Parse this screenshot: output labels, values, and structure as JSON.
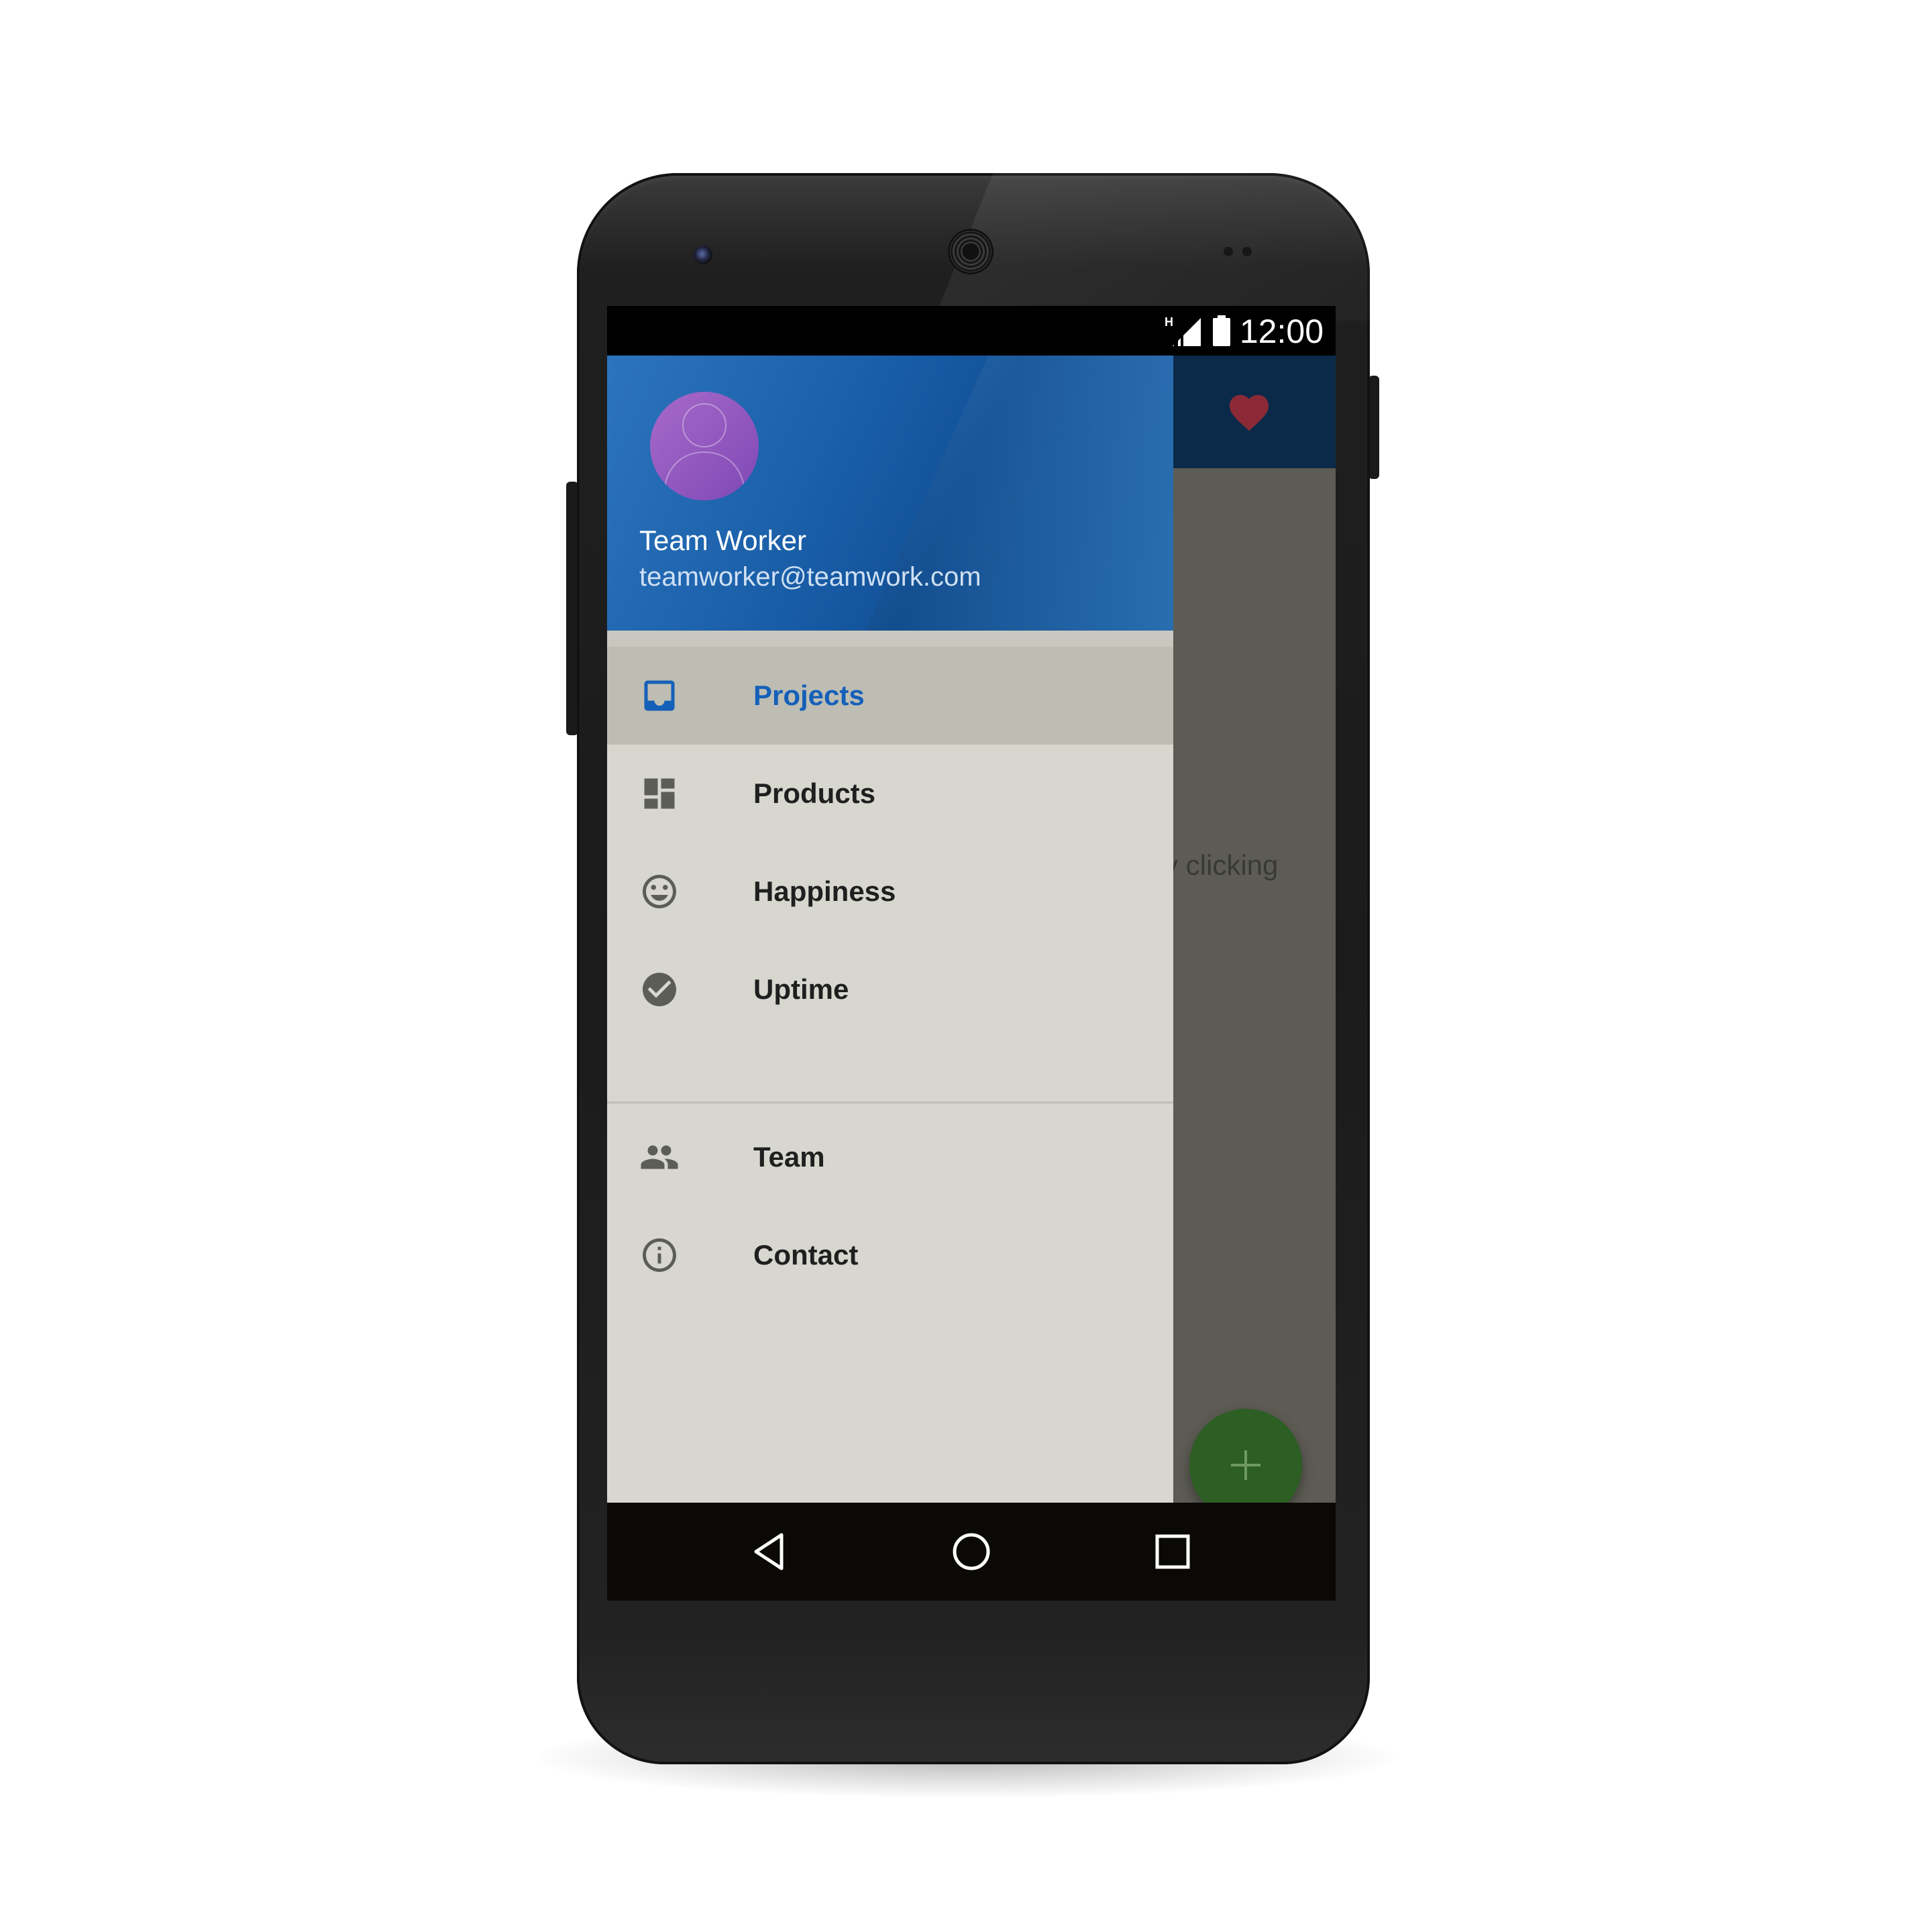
{
  "status_bar": {
    "network_type": "H",
    "icons": [
      "network-type-icon",
      "signal-icon",
      "battery-icon"
    ],
    "time": "12:00"
  },
  "app_behind": {
    "toolbar_icon": "heart-icon",
    "partial_text": "y clicking",
    "fab_icon": "plus-icon"
  },
  "drawer": {
    "header": {
      "avatar_icon": "person-icon",
      "name": "Team Worker",
      "email": "teamworker@teamwork.com"
    },
    "items": [
      {
        "label": "Projects",
        "icon": "inbox-icon",
        "active": true
      },
      {
        "label": "Products",
        "icon": "dashboard-icon",
        "active": false
      },
      {
        "label": "Happiness",
        "icon": "smiley-icon",
        "active": false
      },
      {
        "label": "Uptime",
        "icon": "check-circle-icon",
        "active": false
      }
    ],
    "secondary_items": [
      {
        "label": "Team",
        "icon": "people-icon"
      },
      {
        "label": "Contact",
        "icon": "info-icon"
      }
    ]
  },
  "system_nav": {
    "buttons": [
      "back-icon",
      "home-icon",
      "recents-icon"
    ]
  },
  "colors": {
    "drawer_header": "#1a5ea8",
    "active_label": "#1560b8",
    "drawer_bg": "#d7d7cf",
    "active_row": "#bdbdb4",
    "fab": "#2d5e23",
    "heart": "#8b2a36"
  }
}
